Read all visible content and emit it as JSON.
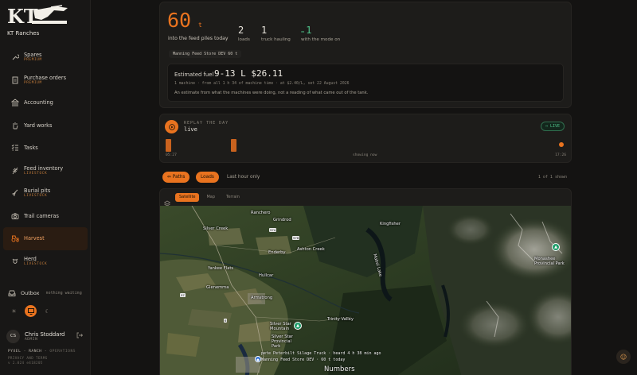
{
  "brand": {
    "name": "KT Ranches"
  },
  "nav": [
    {
      "label": "Spares",
      "sub": "PREMIUM"
    },
    {
      "label": "Purchase orders",
      "sub": "PREMIUM"
    },
    {
      "label": "Accounting",
      "sub": ""
    },
    {
      "label": "Yard works",
      "sub": ""
    },
    {
      "label": "Tasks",
      "sub": ""
    },
    {
      "label": "Feed inventory",
      "sub": "LIVESTOCK"
    },
    {
      "label": "Burial pits",
      "sub": "LIVESTOCK"
    },
    {
      "label": "Trail cameras",
      "sub": ""
    },
    {
      "label": "Harvest",
      "sub": "",
      "active": true
    },
    {
      "label": "Herd",
      "sub": "LIVESTOCK"
    }
  ],
  "outbox": {
    "label": "Outbox",
    "note": "nothing waiting"
  },
  "user": {
    "initials": "CS",
    "name": "Chris Stoddard",
    "role": "ADMIN"
  },
  "footer": {
    "brand_a": "PYXEL",
    "brand_b": "RANCH",
    "brand_c": "OPERATIONS",
    "line1": "PRIVACY AND TERMS",
    "line2": "v 2.024 e418205"
  },
  "stats": {
    "main_value": "60",
    "main_unit": "t",
    "main_label": "into the feed piles today",
    "loads_value": "2",
    "loads_label": "loads",
    "trucks_value": "1",
    "trucks_label": "truck hauling",
    "mode_value": "1",
    "mode_label": "with the mode on",
    "store_chip": "Manning Feed Store DEV 60 t"
  },
  "fuel": {
    "title": "Estimated fuel",
    "value": "9-13 L  $26.11",
    "detail": "1 machine · from all 1 h 34 of machine time · at $2.40/L, set 22 August 2026",
    "note": "An estimate from what the machines were doing, not a reading of what came out of the tank."
  },
  "replay": {
    "label": "REPLAY THE DAY",
    "state": "live",
    "badge": "LIVE",
    "time_start": "05:27",
    "time_mid": "showing now",
    "time_end": "17:26"
  },
  "filters": {
    "paths": "Paths",
    "loads": "Loads",
    "last_hour": "Last hour only",
    "count": "1 of 1 shown"
  },
  "map": {
    "tabs": [
      "Satellite",
      "Map",
      "Terrain"
    ],
    "labels": {
      "ranchero": "Ranchero",
      "grindrod": "Grindrod",
      "silver_creek": "Silver Creek",
      "enderby": "Enderby",
      "ashton_creek": "Ashton Creek",
      "kingfisher": "Kingfisher",
      "mabel_lake": "Mabel Lake",
      "yankee_flats": "Yankee Flats",
      "hullcar": "Hullcar",
      "glenemma": "Glenemma",
      "armstrong": "Armstrong",
      "monashee": "Monashee Provincial Park",
      "trinity_valley": "Trinity Valley",
      "silver_star_mtn": "Silver Star Mountain",
      "silver_star_park": "Silver Star Provincial Park",
      "numbers": "Numbers",
      "road_97a": "97A",
      "road_97b": "97B",
      "road_6": "6",
      "road_97": "97"
    },
    "caption1": "pete Peterbilt Silage Truck · heard 4 h 38 min ago",
    "caption2": "Manning Feed Store DEV · 60 t today"
  }
}
